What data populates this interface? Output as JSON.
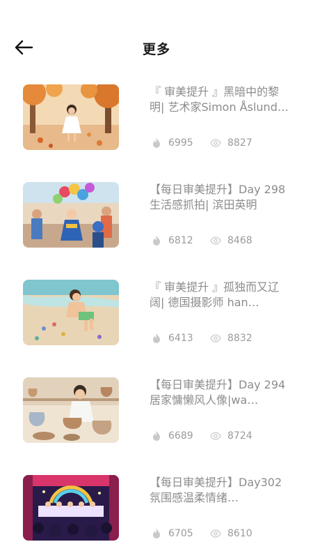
{
  "header": {
    "title": "更多",
    "back_icon": "arrow-left-icon"
  },
  "items": [
    {
      "title": "『 审美提升 』黑暗中的黎明| 艺术家Simon Åslund…",
      "likes": "6995",
      "views": "8827"
    },
    {
      "title": "【每日审美提升】Day 298 生活感抓拍| 滨田英明",
      "likes": "6812",
      "views": "8468"
    },
    {
      "title": "『 审美提升 』孤独而又辽阔| 德国摄影师 han…",
      "likes": "6413",
      "views": "8832"
    },
    {
      "title": "【每日审美提升】Day 294 居家慵懒风人像|wa…",
      "likes": "6689",
      "views": "8724"
    },
    {
      "title": "【每日审美提升】Day302 氛围感温柔情绪…",
      "likes": "6705",
      "views": "8610"
    }
  ],
  "icons": {
    "likes": "flame-icon",
    "views": "eye-icon"
  },
  "colors": {
    "title": "#1a1a1a",
    "item_text": "#8c8c8c",
    "stat_text": "#9a9a9a"
  }
}
